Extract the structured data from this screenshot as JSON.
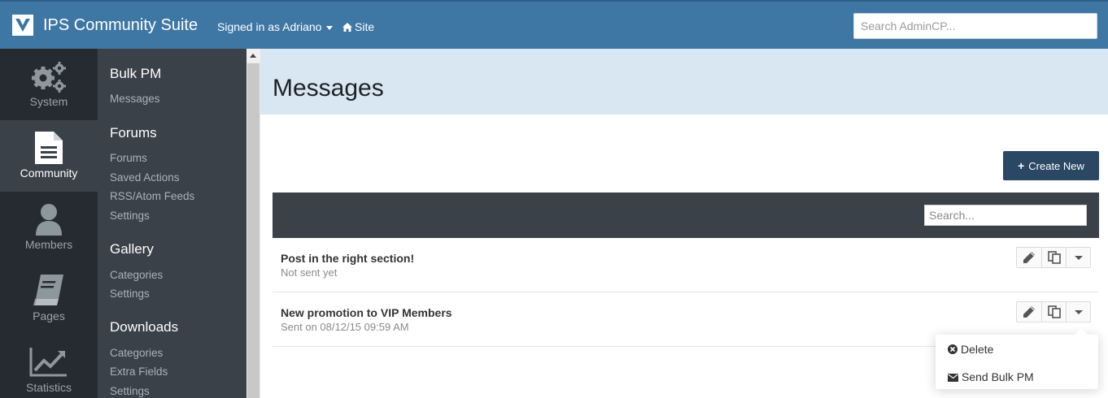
{
  "header": {
    "app_title": "IPS Community Suite",
    "signed_in": "Signed in as Adriano",
    "site_link": "Site",
    "search_placeholder": "Search AdminCP...",
    "bar_color": "#3e77a4"
  },
  "icon_nav": [
    {
      "label": "System",
      "icon": "gears-icon"
    },
    {
      "label": "Community",
      "icon": "document-icon",
      "active": true
    },
    {
      "label": "Members",
      "icon": "user-icon"
    },
    {
      "label": "Pages",
      "icon": "book-icon"
    },
    {
      "label": "Statistics",
      "icon": "line-chart-icon"
    }
  ],
  "sub_menu": {
    "bulk_pm": {
      "heading": "Bulk PM",
      "links": [
        "Messages"
      ]
    },
    "forums": {
      "heading": "Forums",
      "links": [
        "Forums",
        "Saved Actions",
        "RSS/Atom Feeds",
        "Settings"
      ]
    },
    "gallery": {
      "heading": "Gallery",
      "links": [
        "Categories",
        "Settings"
      ]
    },
    "downloads": {
      "heading": "Downloads",
      "links": [
        "Categories",
        "Extra Fields",
        "Settings"
      ]
    }
  },
  "main": {
    "page_title": "Messages",
    "create_button": "Create New",
    "table_search_placeholder": "Search...",
    "rows": [
      {
        "title": "Post in the right section!",
        "status": "Not sent yet"
      },
      {
        "title": "New promotion to VIP Members",
        "status": "Sent on 08/12/15 09:59 AM"
      }
    ],
    "dropdown": {
      "delete": "Delete",
      "send": "Send Bulk PM"
    }
  }
}
